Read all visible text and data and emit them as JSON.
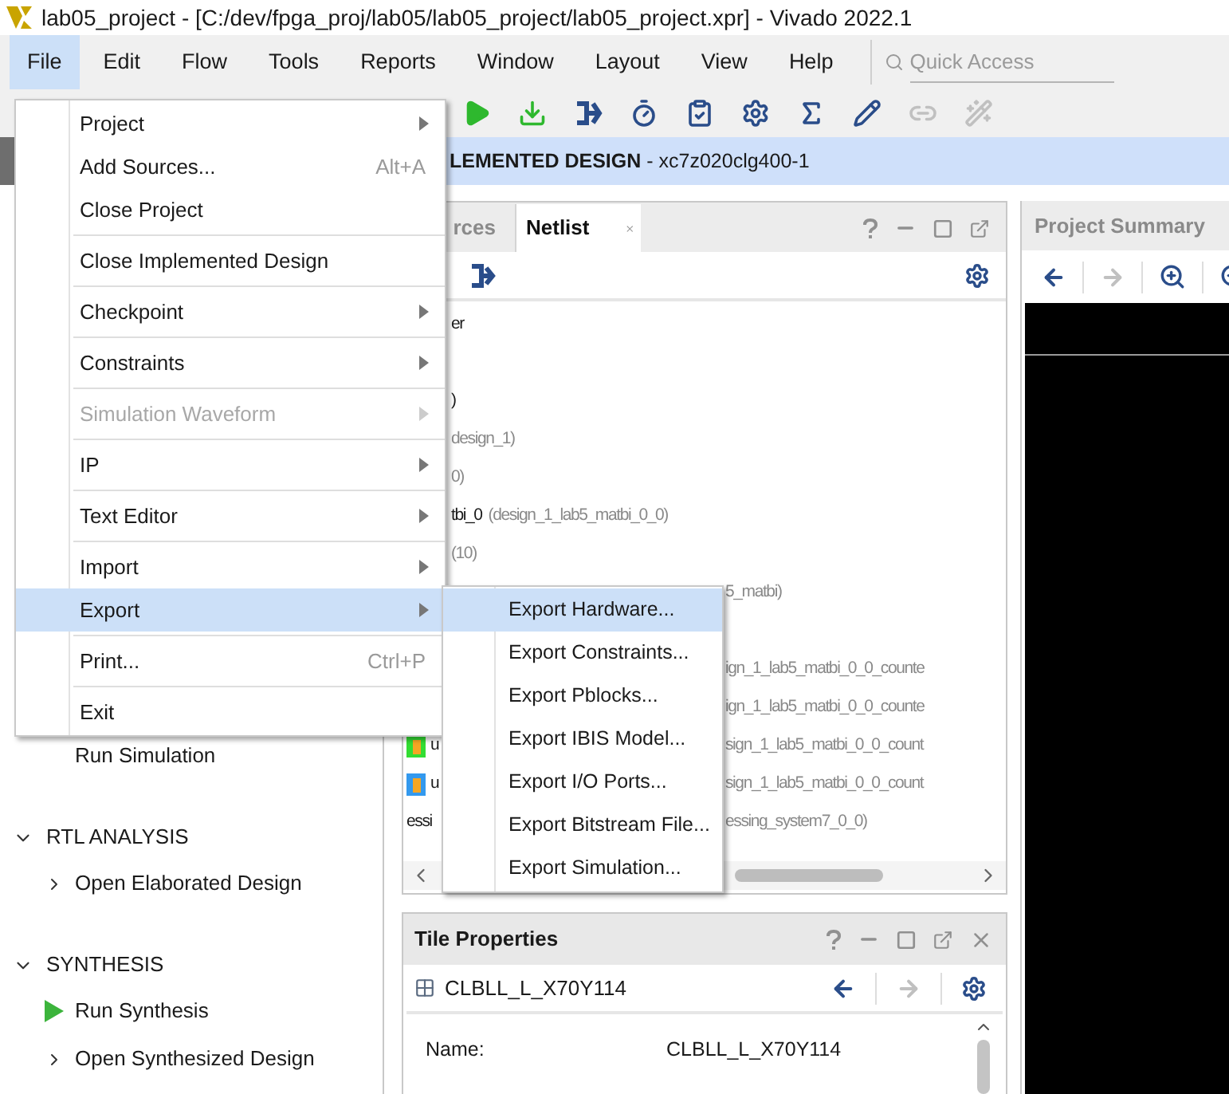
{
  "window": {
    "title": "lab05_project - [C:/dev/fpga_proj/lab05/lab05_project/lab05_project.xpr] - Vivado 2022.1"
  },
  "menu_bar": {
    "items": [
      {
        "label": "File",
        "selected": true
      },
      {
        "label": "Edit",
        "selected": false
      },
      {
        "label": "Flow",
        "selected": false
      },
      {
        "label": "Tools",
        "selected": false
      },
      {
        "label": "Reports",
        "selected": false
      },
      {
        "label": "Window",
        "selected": false
      },
      {
        "label": "Layout",
        "selected": false
      },
      {
        "label": "View",
        "selected": false
      },
      {
        "label": "Help",
        "selected": false
      }
    ],
    "search": {
      "placeholder": "Quick Access"
    }
  },
  "toolbar": {
    "buttons": [
      {
        "kind": "run",
        "disabled": false
      },
      {
        "kind": "program",
        "disabled": false
      },
      {
        "kind": "bracket",
        "disabled": false
      },
      {
        "kind": "timer",
        "disabled": false
      },
      {
        "kind": "clipboard",
        "disabled": false
      },
      {
        "kind": "settings",
        "disabled": false
      },
      {
        "kind": "sigma",
        "disabled": false
      },
      {
        "kind": "pencil",
        "disabled": false
      },
      {
        "kind": "link",
        "disabled": true
      },
      {
        "kind": "cross",
        "disabled": true
      }
    ]
  },
  "banner": {
    "title": "LEMENTED DESIGN",
    "part": " - xc7z020clg400-1"
  },
  "flow_navigator": {
    "sections": [
      {
        "children": [
          {
            "kind": "action",
            "label": "Run Simulation"
          }
        ]
      },
      {
        "label": "RTL ANALYSIS",
        "expanded": true,
        "children": [
          {
            "kind": "link",
            "label": "Open Elaborated Design"
          }
        ]
      },
      {
        "label": "SYNTHESIS",
        "expanded": true,
        "children": [
          {
            "kind": "run",
            "label": "Run Synthesis"
          },
          {
            "kind": "link",
            "label": "Open Synthesized Design"
          }
        ]
      }
    ]
  },
  "netlist_panel": {
    "tabs": [
      {
        "label": "rces",
        "selected": false
      },
      {
        "label": "Netlist",
        "selected": true
      }
    ],
    "rows": [
      {
        "name": "er"
      },
      {},
      {
        "name": ")"
      },
      {
        "detail": "design_1)"
      },
      {
        "detail": "0)"
      },
      {
        "name": "tbi_0",
        "detail": "(design_1_lab5_matbi_0_0)"
      },
      {
        "detail": "(10)"
      },
      {
        "detail": "5_matbi)"
      },
      {},
      {
        "detail": "ign_1_lab5_matbi_0_0_counte"
      },
      {
        "detail": "ign_1_lab5_matbi_0_0_counte"
      },
      {
        "lead": "u",
        "color": "#33dd33",
        "detail": "sign_1_lab5_matbi_0_0_count"
      },
      {
        "lead": "u",
        "color": "#3399ee",
        "detail": "sign_1_lab5_matbi_0_0_count"
      },
      {
        "lead": "essi",
        "detail": "essing_system7_0_0)"
      }
    ]
  },
  "tile_properties": {
    "title": "Tile Properties",
    "tile": "CLBLL_L_X70Y114",
    "properties": [
      {
        "name": "Name:",
        "value": "CLBLL_L_X70Y114"
      }
    ]
  },
  "project_summary": {
    "tab": "Project Summary"
  },
  "file_menu": {
    "items": [
      {
        "kind": "item",
        "label": "Project",
        "submenu": true,
        "selected": false,
        "disabled": false
      },
      {
        "kind": "item",
        "label": "Add Sources...",
        "shortcut": "Alt+A",
        "submenu": false,
        "selected": false,
        "disabled": false
      },
      {
        "kind": "item",
        "label": "Close Project",
        "submenu": false,
        "selected": false,
        "disabled": false
      },
      {
        "kind": "separator"
      },
      {
        "kind": "item",
        "label": "Close Implemented Design",
        "submenu": false,
        "selected": false,
        "disabled": false
      },
      {
        "kind": "separator"
      },
      {
        "kind": "item",
        "label": "Checkpoint",
        "submenu": true,
        "selected": false,
        "disabled": false
      },
      {
        "kind": "separator"
      },
      {
        "kind": "item",
        "label": "Constraints",
        "submenu": true,
        "selected": false,
        "disabled": false
      },
      {
        "kind": "separator"
      },
      {
        "kind": "item",
        "label": "Simulation Waveform",
        "submenu": true,
        "selected": false,
        "disabled": true
      },
      {
        "kind": "separator"
      },
      {
        "kind": "item",
        "label": "IP",
        "submenu": true,
        "selected": false,
        "disabled": false
      },
      {
        "kind": "separator"
      },
      {
        "kind": "item",
        "label": "Text Editor",
        "submenu": true,
        "selected": false,
        "disabled": false
      },
      {
        "kind": "separator"
      },
      {
        "kind": "item",
        "label": "Import",
        "submenu": true,
        "selected": false,
        "disabled": false
      },
      {
        "kind": "item",
        "label": "Export",
        "submenu": true,
        "selected": true,
        "disabled": false
      },
      {
        "kind": "separator"
      },
      {
        "kind": "item",
        "label": "Print...",
        "shortcut": "Ctrl+P",
        "submenu": false,
        "selected": false,
        "disabled": false
      },
      {
        "kind": "separator"
      },
      {
        "kind": "item",
        "label": "Exit",
        "submenu": false,
        "selected": false,
        "disabled": false
      }
    ]
  },
  "export_submenu": {
    "items": [
      {
        "label": "Export Hardware...",
        "selected": true
      },
      {
        "label": "Export Constraints...",
        "selected": false
      },
      {
        "label": "Export Pblocks...",
        "selected": false
      },
      {
        "label": "Export IBIS Model...",
        "selected": false
      },
      {
        "label": "Export I/O Ports...",
        "selected": false
      },
      {
        "label": "Export Bitstream File...",
        "selected": false
      },
      {
        "label": "Export Simulation...",
        "selected": false
      }
    ]
  }
}
